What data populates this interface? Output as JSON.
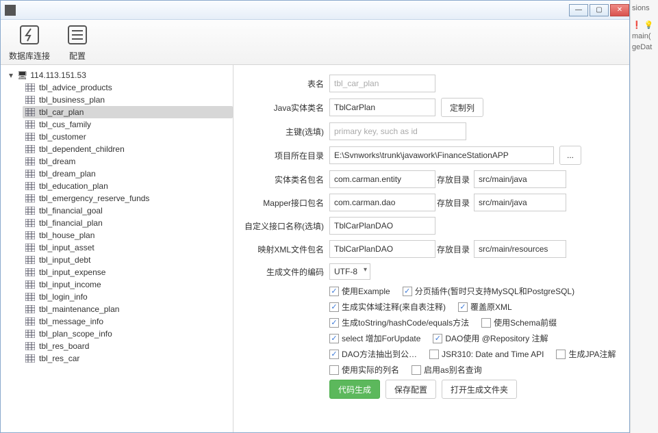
{
  "toolbar": {
    "db_label": "数据库连接",
    "config_label": "配置"
  },
  "tree": {
    "root": "114.113.151.53",
    "items": [
      {
        "label": "tbl_advice_products"
      },
      {
        "label": "tbl_business_plan"
      },
      {
        "label": "tbl_car_plan",
        "selected": true
      },
      {
        "label": "tbl_cus_family"
      },
      {
        "label": "tbl_customer"
      },
      {
        "label": "tbl_dependent_children"
      },
      {
        "label": "tbl_dream"
      },
      {
        "label": "tbl_dream_plan"
      },
      {
        "label": "tbl_education_plan"
      },
      {
        "label": "tbl_emergency_reserve_funds"
      },
      {
        "label": "tbl_financial_goal"
      },
      {
        "label": "tbl_financial_plan"
      },
      {
        "label": "tbl_house_plan"
      },
      {
        "label": "tbl_input_asset"
      },
      {
        "label": "tbl_input_debt"
      },
      {
        "label": "tbl_input_expense"
      },
      {
        "label": "tbl_input_income"
      },
      {
        "label": "tbl_login_info"
      },
      {
        "label": "tbl_maintenance_plan"
      },
      {
        "label": "tbl_message_info"
      },
      {
        "label": "tbl_plan_scope_info"
      },
      {
        "label": "tbl_res_board"
      },
      {
        "label": "tbl_res_car"
      }
    ]
  },
  "form": {
    "labels": {
      "table": "表名",
      "entity": "Java实体类名",
      "pk": "主键(选填)",
      "dir": "项目所在目录",
      "entity_pkg": "实体类名包名",
      "mapper_pkg": "Mapper接口包名",
      "custom_if": "自定义接口名称(选填)",
      "xml_pkg": "映射XML文件包名",
      "save_dir": "存放目录",
      "encoding": "生成文件的编码"
    },
    "values": {
      "table": "tbl_car_plan",
      "entity": "TblCarPlan",
      "pk_placeholder": "primary key, such as id",
      "dir": "E:\\Svnworks\\trunk\\javawork\\FinanceStationAPP",
      "entity_pkg": "com.carman.entity",
      "mapper_pkg": "com.carman.dao",
      "custom_if": "TblCarPlanDAO",
      "xml_pkg": "TblCarPlanDAO",
      "save_java": "src/main/java",
      "save_res": "src/main/resources",
      "encoding": "UTF-8"
    },
    "buttons": {
      "custom_cols": "定制列",
      "browse": "...",
      "generate": "代码生成",
      "save_cfg": "保存配置",
      "open_folder": "打开生成文件夹"
    },
    "checks": {
      "use_example": "使用Example",
      "paging": "分页插件(暂时只支持MySQL和PostgreSQL)",
      "field_comment": "生成实体域注释(来自表注释)",
      "overwrite_xml": "覆盖原XML",
      "tostring": "生成toString/hashCode/equals方法",
      "schema_prefix": "使用Schema前缀",
      "for_update": "select 增加ForUpdate",
      "repo_anno": "DAO使用 @Repository 注解",
      "dao_pub": "DAO方法抽出到公…",
      "jsr310": "JSR310: Date and Time API",
      "jpa": "生成JPA注解",
      "real_col": "使用实际的列名",
      "as_alias": "启用as别名查询"
    }
  },
  "side": {
    "a": "sions",
    "b": "",
    "c": "main(",
    "d": "geDat"
  }
}
